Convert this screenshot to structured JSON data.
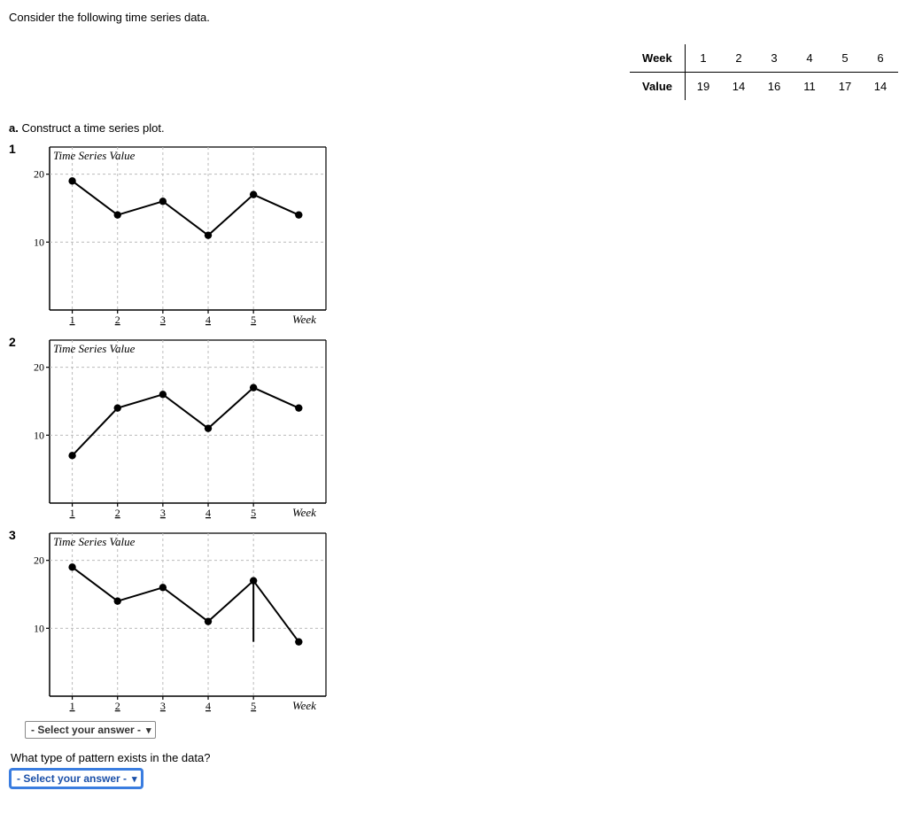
{
  "prompt": "Consider the following time series data.",
  "table": {
    "rowLabels": [
      "Week",
      "Value"
    ],
    "weeks": [
      "1",
      "2",
      "3",
      "4",
      "5",
      "6"
    ],
    "values": [
      "19",
      "14",
      "16",
      "11",
      "17",
      "14"
    ]
  },
  "questionA": "a.",
  "questionA_text": " Construct a time series plot.",
  "charts": [
    {
      "num": "1",
      "title": "Time   Series    Value",
      "xlabel": "Week"
    },
    {
      "num": "2",
      "title": "Time   Series    Value",
      "xlabel": "Week"
    },
    {
      "num": "3",
      "title": "Time   Series    Value",
      "xlabel": "Week"
    }
  ],
  "select_placeholder": "- Select your answer -",
  "followup_q": "What type of pattern exists in the data?",
  "chart_data": [
    {
      "type": "line",
      "title": "Time Series Value",
      "xlabel": "Week",
      "ylabel": "",
      "xticks": [
        1,
        2,
        3,
        4,
        5
      ],
      "yticks": [
        10,
        20
      ],
      "ylim": [
        0,
        24
      ],
      "points": [
        {
          "x": 1,
          "y": 19
        },
        {
          "x": 2,
          "y": 14
        },
        {
          "x": 3,
          "y": 16
        },
        {
          "x": 4,
          "y": 11
        },
        {
          "x": 5,
          "y": 17
        },
        {
          "x": 6,
          "y": 14
        }
      ]
    },
    {
      "type": "line",
      "title": "Time Series Value",
      "xlabel": "Week",
      "ylabel": "",
      "xticks": [
        1,
        2,
        3,
        4,
        5
      ],
      "yticks": [
        10,
        20
      ],
      "ylim": [
        0,
        24
      ],
      "points": [
        {
          "x": 1,
          "y": 7
        },
        {
          "x": 2,
          "y": 14
        },
        {
          "x": 3,
          "y": 16
        },
        {
          "x": 4,
          "y": 11
        },
        {
          "x": 5,
          "y": 17
        },
        {
          "x": 6,
          "y": 14
        }
      ]
    },
    {
      "type": "line",
      "title": "Time Series Value",
      "xlabel": "Week",
      "ylabel": "",
      "xticks": [
        1,
        2,
        3,
        4,
        5
      ],
      "yticks": [
        10,
        20
      ],
      "ylim": [
        0,
        24
      ],
      "points": [
        {
          "x": 1,
          "y": 19
        },
        {
          "x": 2,
          "y": 14
        },
        {
          "x": 3,
          "y": 16
        },
        {
          "x": 4,
          "y": 11
        },
        {
          "x": 5,
          "y": 17
        },
        {
          "x": 6,
          "y": 8
        }
      ],
      "extra_segment": {
        "x": 5,
        "y0": 17,
        "y1": 8
      }
    }
  ]
}
